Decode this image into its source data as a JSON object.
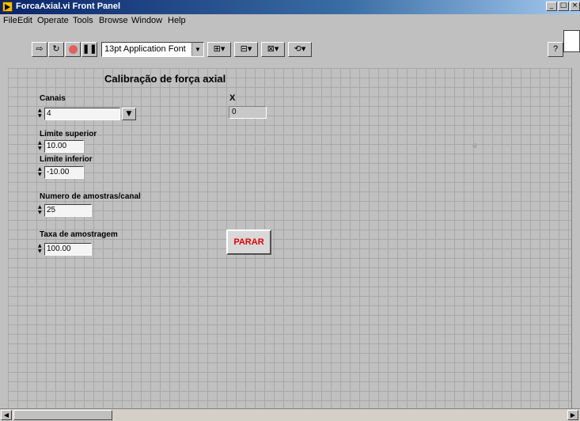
{
  "window": {
    "title": "ForcaAxial.vi Front Panel"
  },
  "menu": [
    "File",
    "Edit",
    "Operate",
    "Tools",
    "Browse",
    "Window",
    "Help"
  ],
  "toolbar": {
    "font_ring_value": "13pt Application Font",
    "help_label": "?"
  },
  "panel": {
    "heading": "Calibração de força axial",
    "canais": {
      "label": "Canais",
      "value": "4"
    },
    "x": {
      "label": "X",
      "value": "0"
    },
    "limite_superior": {
      "label": "Limite superior",
      "value": "10.00"
    },
    "limite_inferior": {
      "label": "Limite inferior",
      "value": "-10.00"
    },
    "numero_amostras": {
      "label": "Numero de amostras/canal",
      "value": "25"
    },
    "taxa_amostragem": {
      "label": "Taxa de amostragem",
      "value": "100.00"
    },
    "stop_button": {
      "label": "PARAR",
      "color": "#e00000"
    }
  }
}
